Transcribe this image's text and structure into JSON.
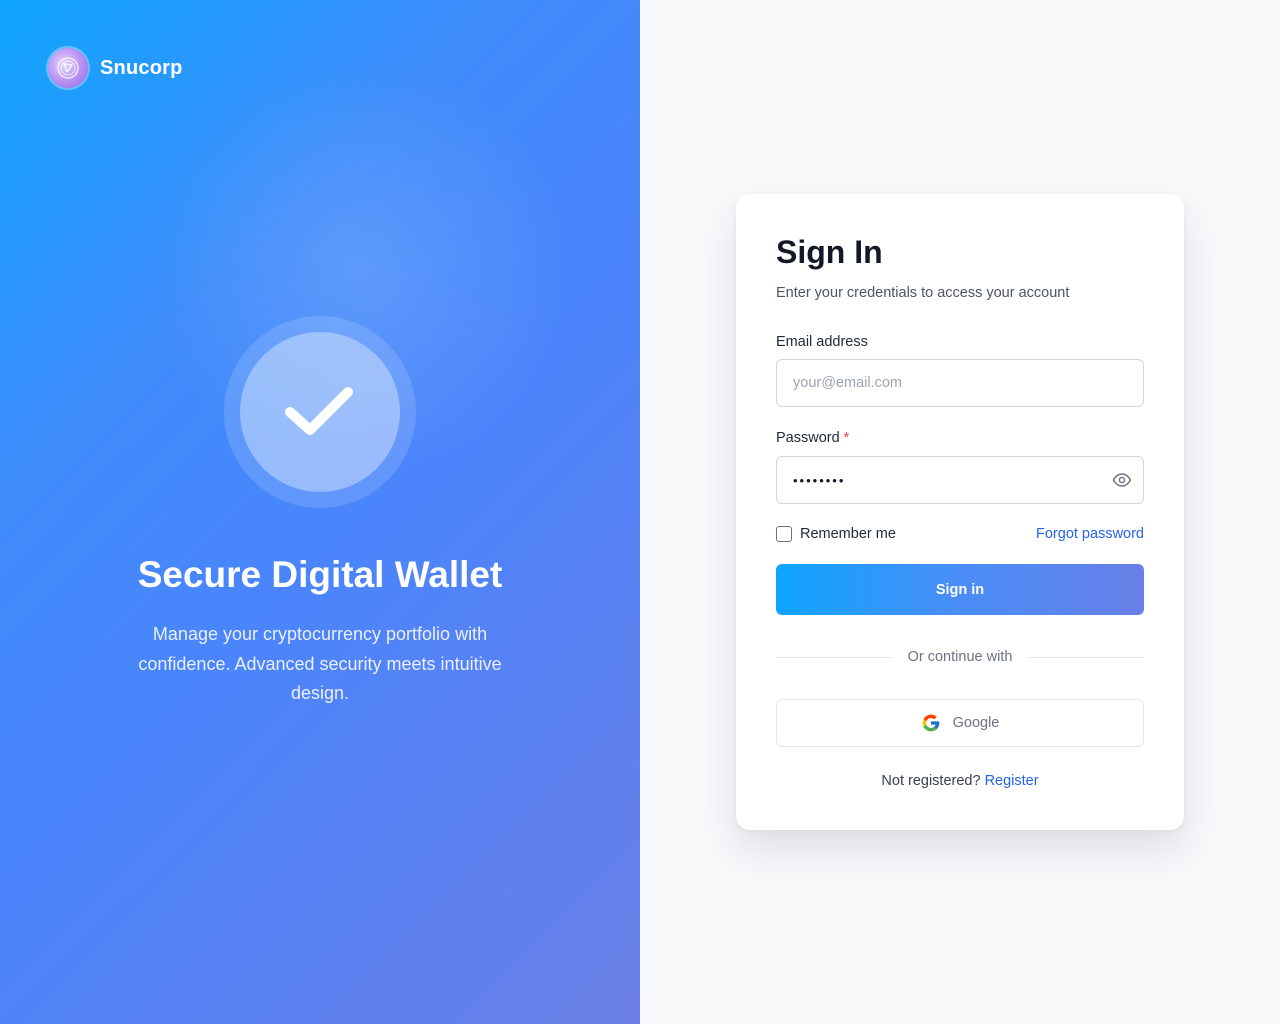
{
  "brand": {
    "name": "Snucorp"
  },
  "hero": {
    "title": "Secure Digital Wallet",
    "subtitle": "Manage your cryptocurrency portfolio with confidence. Advanced security meets intuitive design."
  },
  "form": {
    "title": "Sign In",
    "subtitle": "Enter your credentials to access your account",
    "email": {
      "label": "Email address",
      "placeholder": "your@email.com",
      "value": ""
    },
    "password": {
      "label": "Password",
      "required_mark": "*",
      "value": "••••••••"
    },
    "remember_label": "Remember me",
    "remember_checked": false,
    "forgot_label": "Forgot password",
    "submit_label": "Sign in",
    "divider_text": "Or continue with",
    "google_label": "Google",
    "register_prompt": "Not registered?",
    "register_link": "Register"
  },
  "colors": {
    "accent": "#2563eb",
    "gradient_start": "#0ea5fe",
    "gradient_end": "#687fe7",
    "required": "#ef4444"
  },
  "icons": {
    "brand": "brand-logo-icon",
    "hero": "checkmark-icon",
    "password_toggle": "eye-icon",
    "google": "google-icon"
  }
}
